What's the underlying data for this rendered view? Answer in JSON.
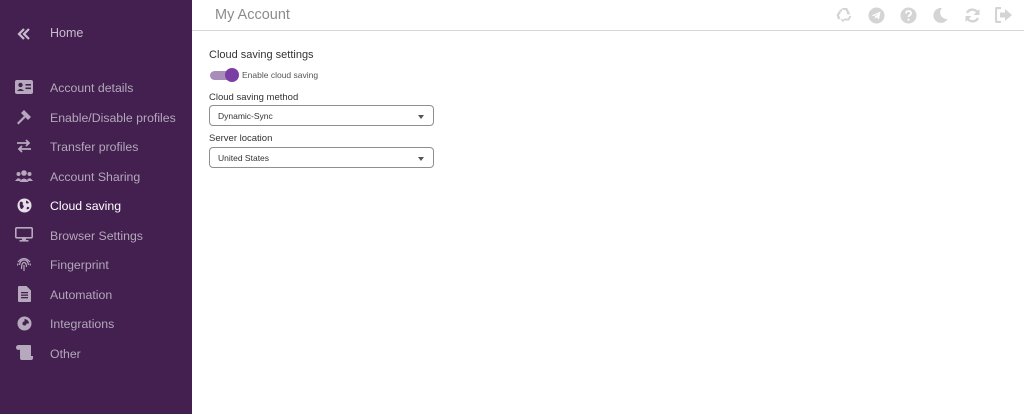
{
  "sidebar": {
    "home_label": "Home",
    "items": [
      {
        "label": "Account details",
        "icon": "id-card-icon"
      },
      {
        "label": "Enable/Disable profiles",
        "icon": "hammer-icon"
      },
      {
        "label": "Transfer profiles",
        "icon": "transfer-arrows-icon"
      },
      {
        "label": "Account Sharing",
        "icon": "users-icon"
      },
      {
        "label": "Cloud saving",
        "icon": "globe-icon",
        "active": true
      },
      {
        "label": "Browser Settings",
        "icon": "monitor-icon"
      },
      {
        "label": "Fingerprint",
        "icon": "fingerprint-icon"
      },
      {
        "label": "Automation",
        "icon": "file-code-icon"
      },
      {
        "label": "Integrations",
        "icon": "pie-icon"
      },
      {
        "label": "Other",
        "icon": "scroll-icon"
      }
    ]
  },
  "header": {
    "title": "My Account",
    "icons": [
      "recycle-icon",
      "telegram-icon",
      "help-icon",
      "moon-icon",
      "sync-icon",
      "logout-icon"
    ]
  },
  "cloud": {
    "section_title": "Cloud saving settings",
    "toggle_label": "Enable cloud saving",
    "toggle_on": true,
    "method_label": "Cloud saving method",
    "method_value": "Dynamic-Sync",
    "location_label": "Server location",
    "location_value": "United States"
  },
  "colors": {
    "sidebar_bg": "#43204f",
    "accent": "#7b3fa3"
  }
}
